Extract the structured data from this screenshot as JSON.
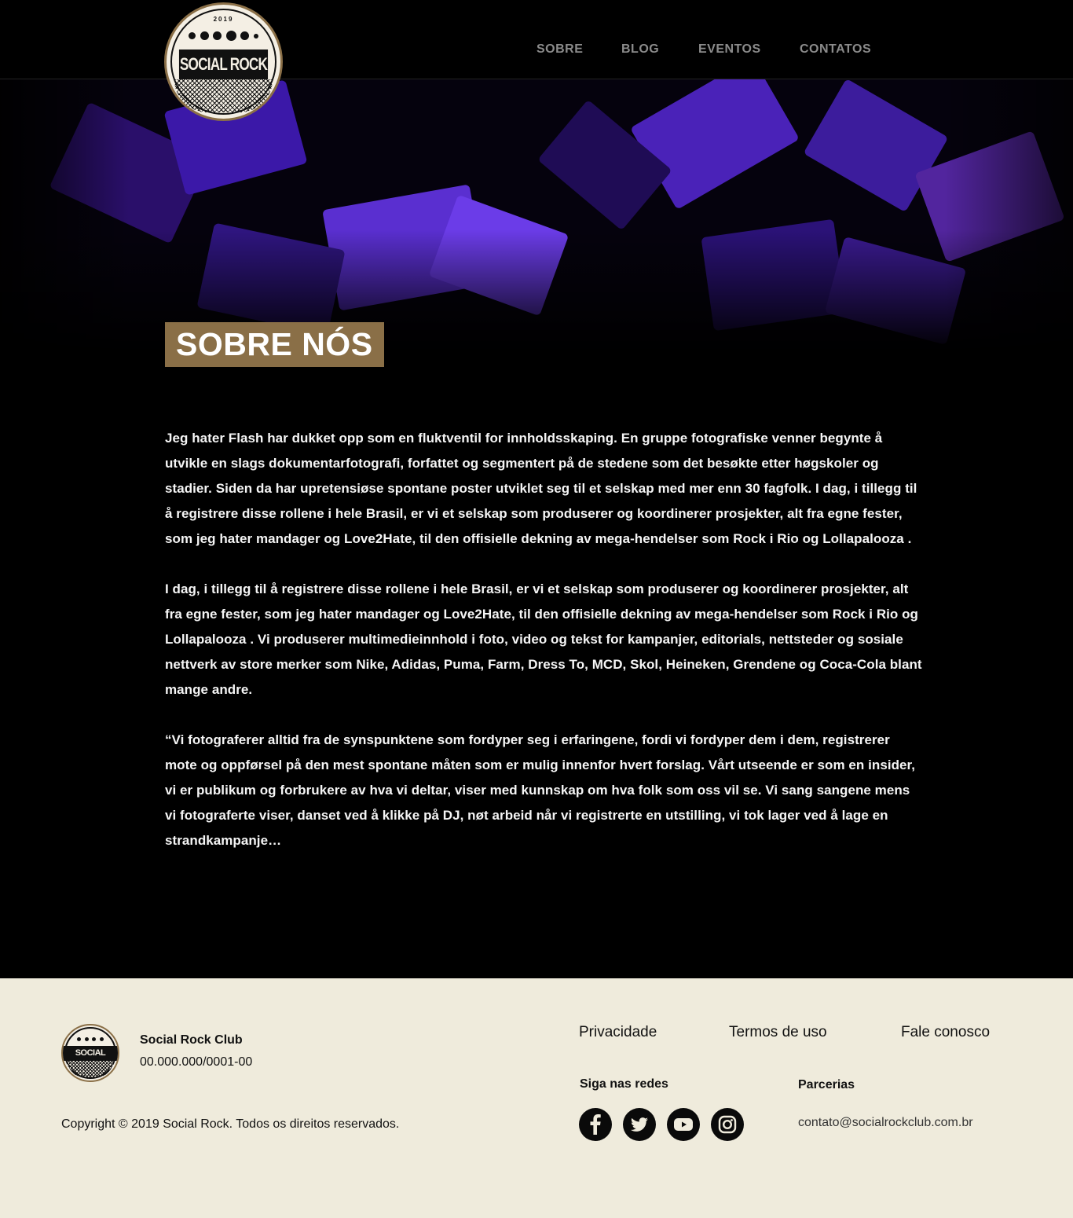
{
  "header": {
    "logo": {
      "year": "2019",
      "name": "SOCIAL ROCK CLUB"
    },
    "nav": [
      "SOBRE",
      "BLOG",
      "EVENTOS",
      "CONTATOS"
    ]
  },
  "hero": {
    "title": "SOBRE NÓS"
  },
  "content": {
    "paragraphs": [
      "Jeg hater Flash har dukket opp som en fluktventil for innholdsskaping. En gruppe fotografiske venner begynte å utvikle en slags dokumentarfotografi, forfattet og segmentert på de stedene som det besøkte etter høgskoler og stadier. Siden da har upretensiøse spontane poster utviklet seg til et selskap med mer enn 30 fagfolk. I dag, i tillegg til å registrere disse rollene i hele Brasil, er vi et selskap som produserer og koordinerer prosjekter, alt fra egne fester, som jeg hater mandager og Love2Hate, til den offisielle dekning av mega-hendelser som Rock i Rio og Lollapalooza .",
      "I dag, i tillegg til å registrere disse rollene i hele Brasil, er vi et selskap som produserer og koordinerer prosjekter, alt fra egne fester, som jeg hater mandager og Love2Hate, til den offisielle dekning av mega-hendelser som Rock i Rio og Lollapalooza . Vi produserer multimedieinnhold i foto, video og tekst for kampanjer, editorials, nettsteder og sosiale nettverk av store merker som Nike, Adidas, Puma, Farm, Dress To, MCD, Skol, Heineken, Grendene og Coca-Cola blant mange andre.",
      "“Vi fotograferer alltid fra de synspunktene som fordyper seg i erfaringene, fordi vi fordyper dem i dem, registrerer mote og oppførsel på den mest spontane måten som er mulig innenfor hvert forslag. Vårt utseende er som en insider, vi er publikum og forbrukere av hva vi deltar, viser med kunnskap om hva folk som oss vil se. Vi sang sangene mens vi fotograferte viser, danset ved å klikke på DJ, nøt arbeid når vi registrerte en utstilling, vi tok lager ved å lage en strandkampanje…"
    ]
  },
  "footer": {
    "company_name": "Social Rock Club",
    "cnpj": "00.000.000/0001-00",
    "copyright": "Copyright © 2019 Social Rock. Todos os direitos reservados.",
    "links": [
      "Privacidade",
      "Termos de uso",
      "Fale conosco"
    ],
    "social_heading": "Siga nas redes",
    "social_icons": [
      "facebook-icon",
      "twitter-icon",
      "youtube-icon",
      "instagram-icon"
    ],
    "partners_heading": "Parcerias",
    "email": "contato@socialrockclub.com.br"
  },
  "colors": {
    "background": "#000000",
    "accent": "#8a6f47",
    "nav_text": "#8b8b8b",
    "footer_bg": "#efebdc"
  }
}
